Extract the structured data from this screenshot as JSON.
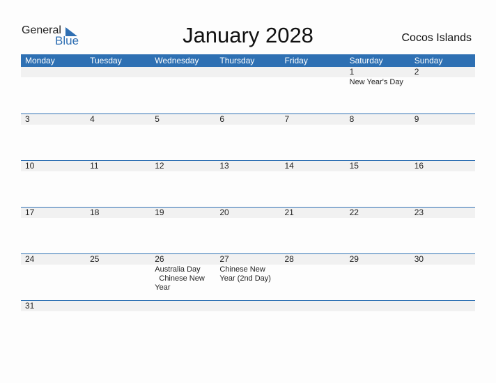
{
  "brand": {
    "general": "General",
    "blue": "Blue"
  },
  "title": "January 2028",
  "country": "Cocos Islands",
  "colors": {
    "accent": "#2e70b3",
    "band": "#f1f1f1"
  },
  "days": [
    "Monday",
    "Tuesday",
    "Wednesday",
    "Thursday",
    "Friday",
    "Saturday",
    "Sunday"
  ],
  "weeks": [
    [
      {
        "d": ""
      },
      {
        "d": ""
      },
      {
        "d": ""
      },
      {
        "d": ""
      },
      {
        "d": ""
      },
      {
        "d": "1",
        "e": "New Year's Day"
      },
      {
        "d": "2"
      }
    ],
    [
      {
        "d": "3"
      },
      {
        "d": "4"
      },
      {
        "d": "5"
      },
      {
        "d": "6"
      },
      {
        "d": "7"
      },
      {
        "d": "8"
      },
      {
        "d": "9"
      }
    ],
    [
      {
        "d": "10"
      },
      {
        "d": "11"
      },
      {
        "d": "12"
      },
      {
        "d": "13"
      },
      {
        "d": "14"
      },
      {
        "d": "15"
      },
      {
        "d": "16"
      }
    ],
    [
      {
        "d": "17"
      },
      {
        "d": "18"
      },
      {
        "d": "19"
      },
      {
        "d": "20"
      },
      {
        "d": "21"
      },
      {
        "d": "22"
      },
      {
        "d": "23"
      }
    ],
    [
      {
        "d": "24"
      },
      {
        "d": "25"
      },
      {
        "d": "26",
        "e": "Australia Day\n  Chinese New Year"
      },
      {
        "d": "27",
        "e": "Chinese New Year (2nd Day)"
      },
      {
        "d": "28"
      },
      {
        "d": "29"
      },
      {
        "d": "30"
      }
    ],
    [
      {
        "d": "31"
      },
      {
        "d": ""
      },
      {
        "d": ""
      },
      {
        "d": ""
      },
      {
        "d": ""
      },
      {
        "d": ""
      },
      {
        "d": ""
      }
    ]
  ]
}
